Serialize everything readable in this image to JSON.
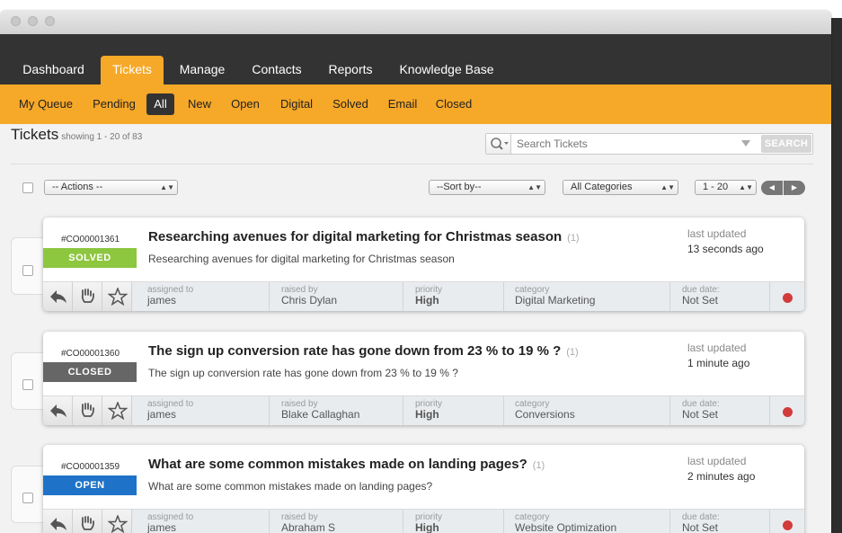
{
  "nav": {
    "items": [
      {
        "label": "Dashboard"
      },
      {
        "label": "Tickets"
      },
      {
        "label": "Manage"
      },
      {
        "label": "Contacts"
      },
      {
        "label": "Reports"
      },
      {
        "label": "Knowledge Base"
      }
    ],
    "active": "Tickets"
  },
  "subnav": {
    "items": [
      {
        "label": "My Queue"
      },
      {
        "label": "Pending"
      },
      {
        "label": "All"
      },
      {
        "label": "New"
      },
      {
        "label": "Open"
      },
      {
        "label": "Digital"
      },
      {
        "label": "Solved"
      },
      {
        "label": "Email"
      },
      {
        "label": "Closed"
      }
    ],
    "active": "All"
  },
  "page": {
    "title": "Tickets",
    "subtitle": "showing 1 - 20 of 83"
  },
  "search": {
    "placeholder": "Search Tickets",
    "button_label": "SEARCH"
  },
  "toolbar": {
    "actions_label": "-- Actions --",
    "sort_label": "--Sort by--",
    "category_label": "All Categories",
    "range_label": "1 - 20",
    "prev_icon": "chevron-left-icon",
    "next_icon": "chevron-right-icon"
  },
  "ticket_labels": {
    "last_updated": "last updated",
    "assigned_to": "assigned to",
    "raised_by": "raised by",
    "priority": "priority",
    "category": "category",
    "due_date": "due date:"
  },
  "tickets": [
    {
      "id": "#CO00001361",
      "status": "SOLVED",
      "status_color": "#8dc63f",
      "title": "Researching avenues for digital marketing for Christmas season",
      "count": "(1)",
      "description": "Researching avenues for digital marketing for Christmas season",
      "updated": "13 seconds ago",
      "assigned_to": "james",
      "raised_by": "Chris Dylan",
      "priority": "High",
      "category": "Digital Marketing",
      "due_date": "Not Set",
      "indicator_color": "#d23b3b"
    },
    {
      "id": "#CO00001360",
      "status": "CLOSED",
      "status_color": "#666666",
      "title": "The sign up conversion rate has gone down from 23 % to 19 % ?",
      "count": "(1)",
      "description": "The sign up conversion rate has gone down from 23 % to 19 % ?",
      "updated": "1 minute ago",
      "assigned_to": "james",
      "raised_by": "Blake Callaghan",
      "priority": "High",
      "category": "Conversions",
      "due_date": "Not Set",
      "indicator_color": "#d23b3b"
    },
    {
      "id": "#CO00001359",
      "status": "OPEN",
      "status_color": "#1e73c8",
      "title": "What are some common mistakes made on landing pages?",
      "count": "(1)",
      "description": "What are some common mistakes made on landing pages?",
      "updated": "2 minutes ago",
      "assigned_to": "james",
      "raised_by": "Abraham S",
      "priority": "High",
      "category": "Website Optimization",
      "due_date": "Not Set",
      "indicator_color": "#d23b3b"
    }
  ],
  "colors": {
    "nav_bg": "#333333",
    "accent": "#f6a828"
  }
}
